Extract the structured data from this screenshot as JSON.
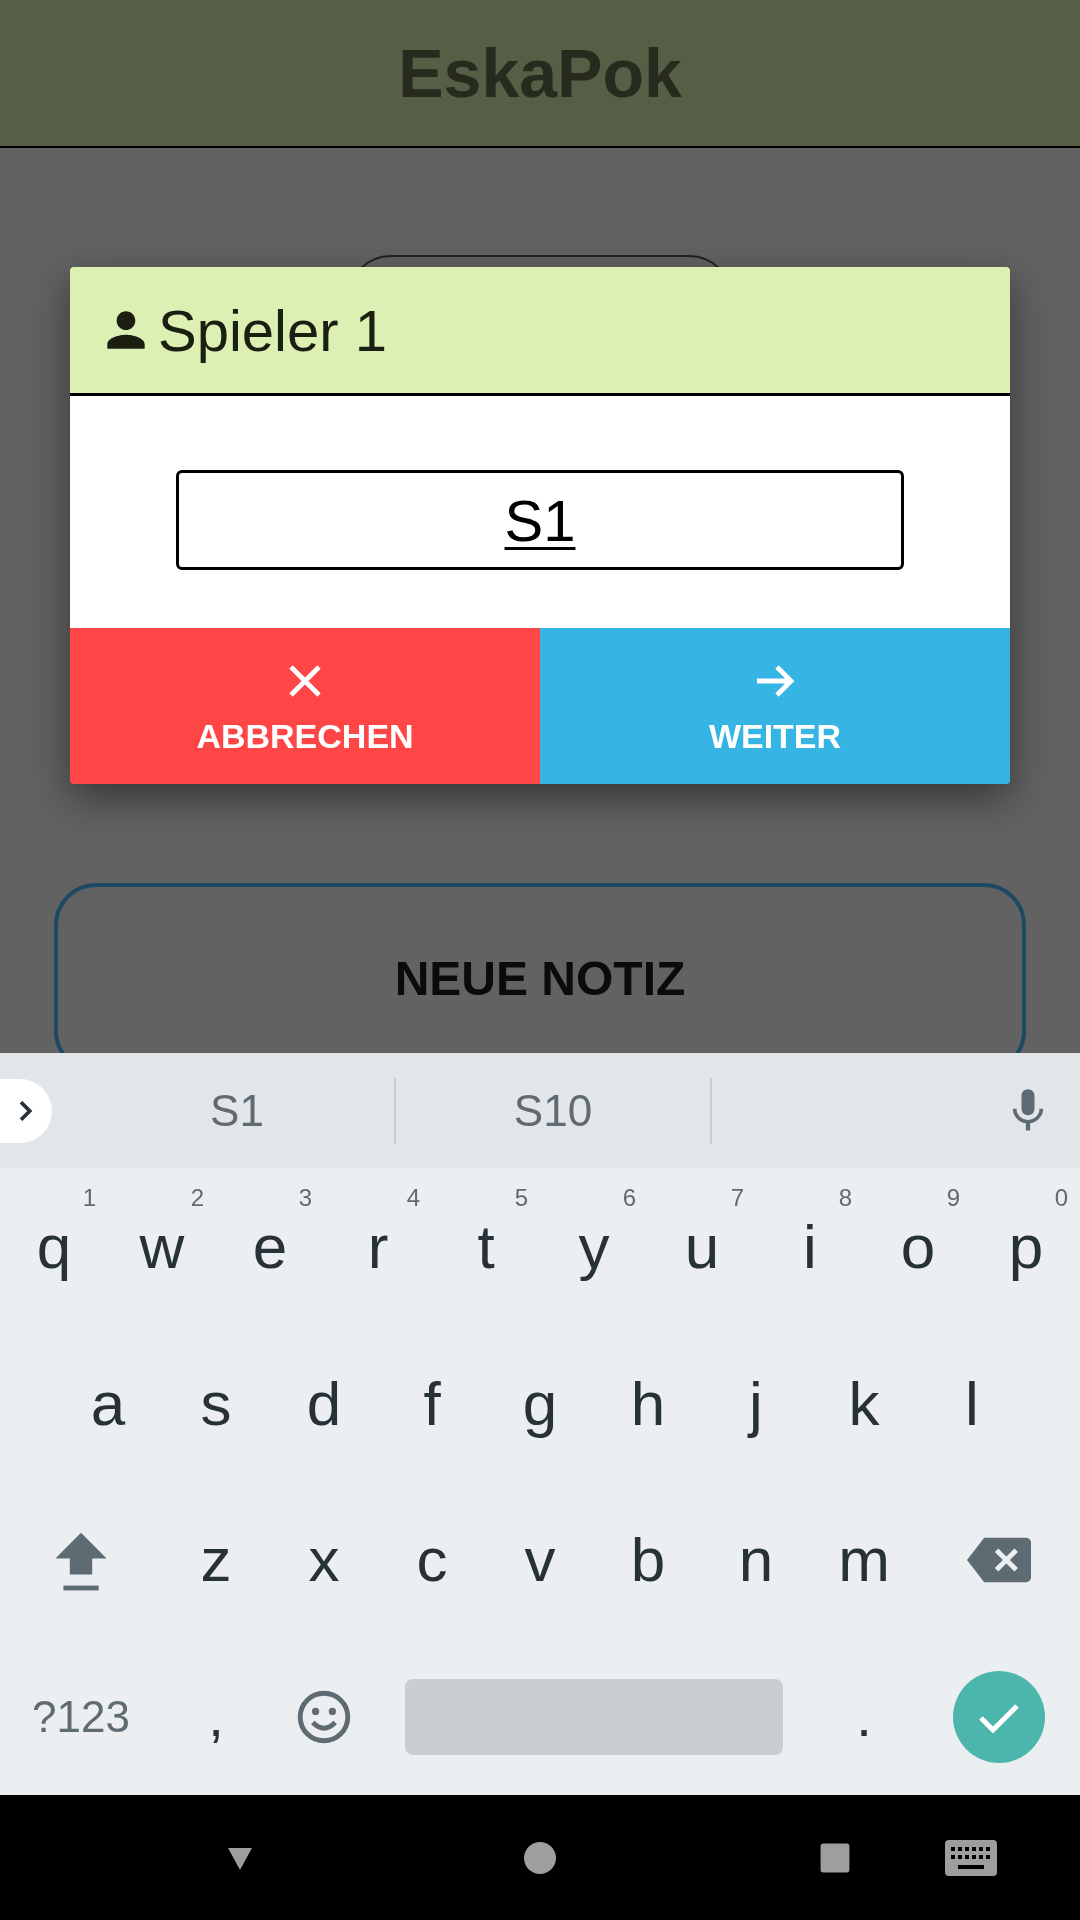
{
  "app_bar": {
    "title": "EskaPok"
  },
  "main": {
    "note_button": {
      "label": "NEUE NOTIZ"
    }
  },
  "dialog": {
    "title": "Spieler 1",
    "input": {
      "value": "S1"
    },
    "buttons": [
      {
        "kind": "cancel",
        "label": "ABBRECHEN"
      },
      {
        "kind": "next",
        "label": "WEITER"
      }
    ]
  },
  "keyboard": {
    "suggestions": [
      "S1",
      "S10"
    ],
    "key_rows": [
      {
        "keys": [
          {
            "kind": "letter",
            "label": "q",
            "hint": "1"
          },
          {
            "kind": "letter",
            "label": "w",
            "hint": "2"
          },
          {
            "kind": "letter",
            "label": "e",
            "hint": "3"
          },
          {
            "kind": "letter",
            "label": "r",
            "hint": "4"
          },
          {
            "kind": "letter",
            "label": "t",
            "hint": "5"
          },
          {
            "kind": "letter",
            "label": "y",
            "hint": "6"
          },
          {
            "kind": "letter",
            "label": "u",
            "hint": "7"
          },
          {
            "kind": "letter",
            "label": "i",
            "hint": "8"
          },
          {
            "kind": "letter",
            "label": "o",
            "hint": "9"
          },
          {
            "kind": "letter",
            "label": "p",
            "hint": "0"
          }
        ]
      },
      {
        "keys": [
          {
            "kind": "letter",
            "label": "a"
          },
          {
            "kind": "letter",
            "label": "s"
          },
          {
            "kind": "letter",
            "label": "d"
          },
          {
            "kind": "letter",
            "label": "f"
          },
          {
            "kind": "letter",
            "label": "g"
          },
          {
            "kind": "letter",
            "label": "h"
          },
          {
            "kind": "letter",
            "label": "j"
          },
          {
            "kind": "letter",
            "label": "k"
          },
          {
            "kind": "letter",
            "label": "l"
          }
        ]
      },
      {
        "keys": [
          {
            "kind": "shift"
          },
          {
            "kind": "letter",
            "label": "z"
          },
          {
            "kind": "letter",
            "label": "x"
          },
          {
            "kind": "letter",
            "label": "c"
          },
          {
            "kind": "letter",
            "label": "v"
          },
          {
            "kind": "letter",
            "label": "b"
          },
          {
            "kind": "letter",
            "label": "n"
          },
          {
            "kind": "letter",
            "label": "m"
          },
          {
            "kind": "backspace"
          }
        ]
      },
      {
        "keys": [
          {
            "kind": "symbols",
            "label": "?123"
          },
          {
            "kind": "char",
            "label": ","
          },
          {
            "kind": "emoji"
          },
          {
            "kind": "space"
          },
          {
            "kind": "char",
            "label": "."
          },
          {
            "kind": "enter"
          }
        ]
      }
    ]
  }
}
